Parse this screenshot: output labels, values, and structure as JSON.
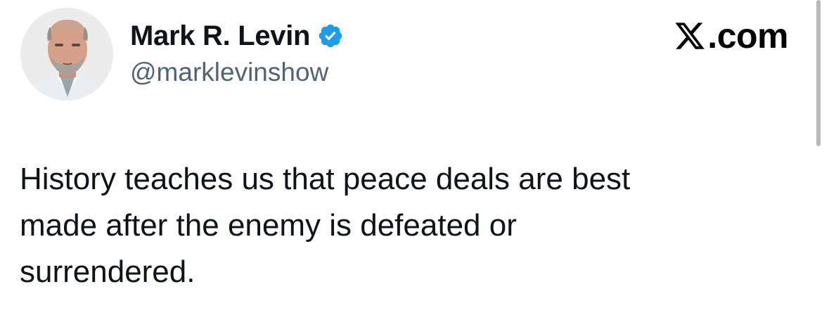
{
  "author": {
    "display_name": "Mark R. Levin",
    "handle": "@marklevinshow",
    "verified": true,
    "verified_color": "#1d9bf0",
    "avatar_icon": "profile-photo"
  },
  "brand": {
    "domain_label": ".com",
    "logo_icon": "x-logo-icon"
  },
  "tweet": {
    "text": "History teaches us that peace deals are best\nmade after the enemy is defeated or\nsurrendered."
  },
  "colors": {
    "text_primary": "#0f1419",
    "text_secondary": "#536471",
    "background": "#ffffff"
  }
}
